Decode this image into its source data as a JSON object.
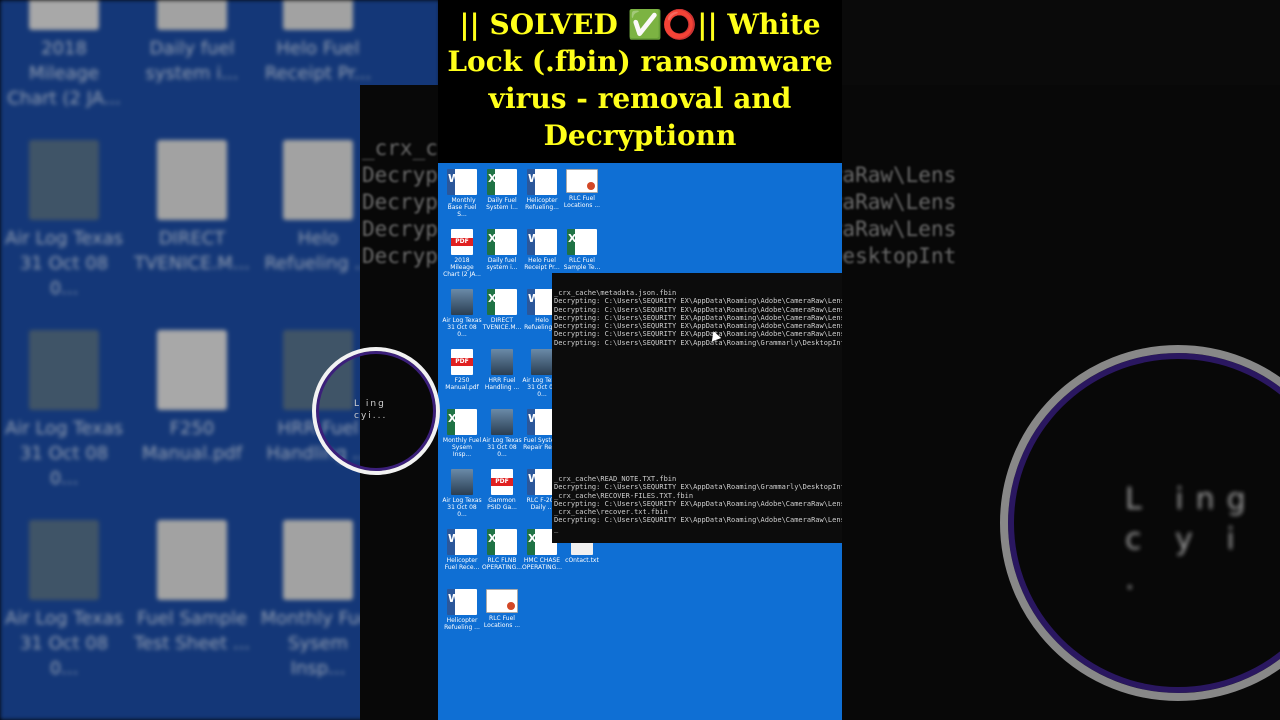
{
  "video_title": {
    "line1": "|| SOLVED ✅⭕|| White",
    "line2": "Lock (.fbin) ransomware",
    "line3": "virus - removal and",
    "line4": "Decryptionn"
  },
  "bg_left_icons": [
    {
      "label": "2018 Mileage Chart (2 JA...",
      "type": "pdf"
    },
    {
      "label": "Daily fuel system i...",
      "type": "excel"
    },
    {
      "label": "Helo Fuel Receipt Pr...",
      "type": "word"
    },
    {
      "label": "Air Log Texas 31 Oct 08 0...",
      "type": "img"
    },
    {
      "label": "DIRECT TVENICE.M...",
      "type": "excel"
    },
    {
      "label": "Helo Refueling ...",
      "type": "word"
    },
    {
      "label": "Air Log Texas 31 Oct 08 0...",
      "type": "img"
    },
    {
      "label": "F250 Manual.pdf",
      "type": "pdf"
    },
    {
      "label": "HRR Fuel Handling ...",
      "type": "img"
    },
    {
      "label": "Air Log Texas 31 Oct 08 0...",
      "type": "img"
    },
    {
      "label": "Fuel Sample Test Sheet ...",
      "type": "excel"
    },
    {
      "label": "Monthly Fuel Sysem Insp...",
      "type": "excel"
    }
  ],
  "bg_terminal_lines": [
    "_crx_c",
    "Decryp        Data\\Roaming\\Adobe\\CameraRaw\\Lens",
    "Decryp        Data\\Roaming\\Adobe\\CameraRaw\\Lens",
    "Decryp        Data\\Roaming\\Adobe\\CameraRaw\\Lens",
    "Decryp        Data\\Roaming\\Grammarly\\DesktopInt"
  ],
  "bg_ring_text": {
    "line1": "L   ing",
    "line2": "c y i ."
  },
  "desktop_icons": [
    {
      "label": "_Monthly Base Fuel S...",
      "type": "word"
    },
    {
      "label": "Daily Fuel System I...",
      "type": "excel"
    },
    {
      "label": "Helicopter Refueling...",
      "type": "word"
    },
    {
      "label": "RLC Fuel Locations ...",
      "type": "ppt"
    },
    {
      "label": "2018 Mileage Chart (2 JA...",
      "type": "pdf"
    },
    {
      "label": "Daily fuel system i...",
      "type": "excel"
    },
    {
      "label": "Helo Fuel Receipt Pr...",
      "type": "word"
    },
    {
      "label": "RLC Fuel Sample Te...",
      "type": "excel"
    },
    {
      "label": "Air Log Texas 31 Oct 08 0...",
      "type": "img"
    },
    {
      "label": "DIRECT TVENICE.M...",
      "type": "excel"
    },
    {
      "label": "Helo Refueling ...",
      "type": "word"
    },
    {
      "label": "Air Log Texas 31 Oct 08 0...",
      "type": "img"
    },
    {
      "label": "F250 Manual.pdf",
      "type": "pdf"
    },
    {
      "label": "HRR Fuel Handling ...",
      "type": "img"
    },
    {
      "label": "Air Log Texas 31 Oct 08 0...",
      "type": "img"
    },
    {
      "label": "Fuel Sample Test Sheet ...",
      "type": "excel"
    },
    {
      "label": "Monthly Fuel Sysem Insp...",
      "type": "excel"
    },
    {
      "label": "Air Log Texas 31 Oct 08 0...",
      "type": "img"
    },
    {
      "label": "Fuel System Repair Rec...",
      "type": "word"
    },
    {
      "label": "Navy MIL-HDBK...",
      "type": "pdf"
    },
    {
      "label": "Air Log Texas 31 Oct 08 0...",
      "type": "img"
    },
    {
      "label": "Gammon PSID Ga...",
      "type": "pdf"
    },
    {
      "label": "RLC F-200 Daily ...",
      "type": "word"
    },
    {
      "label": "Base Fuel Log F-100.xls",
      "type": "excel"
    },
    {
      "label": "Helicopter Fuel Rece...",
      "type": "word"
    },
    {
      "label": "RLC FLNB OPERATING...",
      "type": "excel"
    },
    {
      "label": "HMC CHASE OPERATING...",
      "type": "excel"
    },
    {
      "label": "cOntact.txt",
      "type": "txt"
    },
    {
      "label": "Helicopter Refueling ...",
      "type": "word"
    },
    {
      "label": "RLC Fuel Locations ...",
      "type": "ppt"
    }
  ],
  "terminal": {
    "top_lines": [
      "_crx_cache\\metadata.json.fbin",
      "Decrypting: C:\\Users\\SEQURITY EX\\AppData\\Roaming\\Adobe\\CameraRaw\\Lens",
      "Decrypting: C:\\Users\\SEQURITY EX\\AppData\\Roaming\\Adobe\\CameraRaw\\Lens",
      "Decrypting: C:\\Users\\SEQURITY EX\\AppData\\Roaming\\Adobe\\CameraRaw\\Lens",
      "Decrypting: C:\\Users\\SEQURITY EX\\AppData\\Roaming\\Adobe\\CameraRaw\\Lens",
      "Decrypting: C:\\Users\\SEQURITY EX\\AppData\\Roaming\\Adobe\\CameraRaw\\Lens",
      "Decrypting: C:\\Users\\SEQURITY EX\\AppData\\Roaming\\Grammarly\\DesktopInt"
    ],
    "bottom_lines": [
      "_crx_cache\\READ_NOTE.TXT.fbin",
      "Decrypting: C:\\Users\\SEQURITY EX\\AppData\\Roaming\\Grammarly\\DesktopInt",
      "_crx_cache\\RECOVER-FILES.TXT.fbin",
      "Decrypting: C:\\Users\\SEQURITY EX\\AppData\\Roaming\\Adobe\\CameraRaw\\Lens",
      "_crx_cache\\recover.txt.fbin",
      "Decrypting: C:\\Users\\SEQURITY EX\\AppData\\Roaming\\Adobe\\CameraRaw\\Lens",
      "_"
    ]
  },
  "loading_ring": {
    "line1": "L   ing",
    "line2": "cyi..."
  }
}
